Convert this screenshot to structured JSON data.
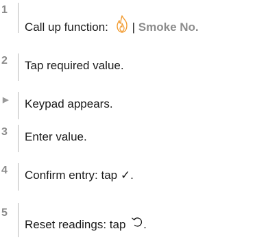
{
  "steps": [
    {
      "marker": "1",
      "text": "Call up function: ",
      "icon": "flame-icon",
      "separator": "| ",
      "link": "Smoke No."
    },
    {
      "marker": "2",
      "text": "Tap required value."
    },
    {
      "marker": "▶",
      "text": "Keypad appears."
    },
    {
      "marker": "3",
      "text": "Enter value."
    },
    {
      "marker": "4",
      "text": "Confirm entry: tap ",
      "glyph": "✓",
      "suffix": "."
    },
    {
      "marker": "5",
      "text": "Reset readings: tap ",
      "icon": "reset-icon",
      "suffix": "."
    }
  ],
  "colors": {
    "flame": "#f29a2e",
    "marker": "#8a8a8a",
    "rule": "#b8b8b8"
  }
}
